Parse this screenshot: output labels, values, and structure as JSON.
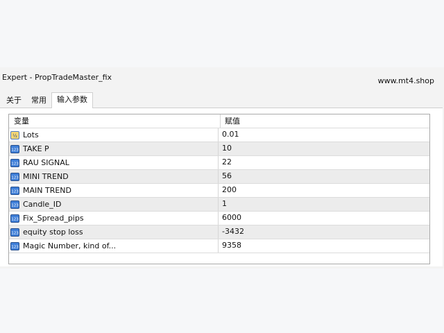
{
  "window": {
    "title": "Expert - PropTradeMaster_fix",
    "watermark": "www.mt4.shop"
  },
  "tabs": [
    {
      "label": "关于",
      "active": false
    },
    {
      "label": "常用",
      "active": false
    },
    {
      "label": "输入参数",
      "active": true
    }
  ],
  "table": {
    "headers": {
      "variable": "变量",
      "value": "赋值"
    },
    "rows": [
      {
        "name": "Lots",
        "value": "0.01",
        "icon": "fraction-icon"
      },
      {
        "name": "TAKE P",
        "value": "10",
        "icon": "integer-icon"
      },
      {
        "name": "RAU SIGNAL",
        "value": "22",
        "icon": "integer-icon"
      },
      {
        "name": "MINI TREND",
        "value": "56",
        "icon": "integer-icon"
      },
      {
        "name": "MAIN TREND",
        "value": "200",
        "icon": "integer-icon"
      },
      {
        "name": "Candle_ID",
        "value": "1",
        "icon": "integer-icon"
      },
      {
        "name": "Fix_Spread_pips",
        "value": "6000",
        "icon": "integer-icon"
      },
      {
        "name": "equity stop loss",
        "value": "-3432",
        "icon": "integer-icon"
      },
      {
        "name": "Magic Number, kind of...",
        "value": "9358",
        "icon": "integer-icon"
      }
    ]
  },
  "colors": {
    "row_alt": "#ececec",
    "icon_blue": "#3a7bd5",
    "icon_yellow": "#f2c94c"
  }
}
